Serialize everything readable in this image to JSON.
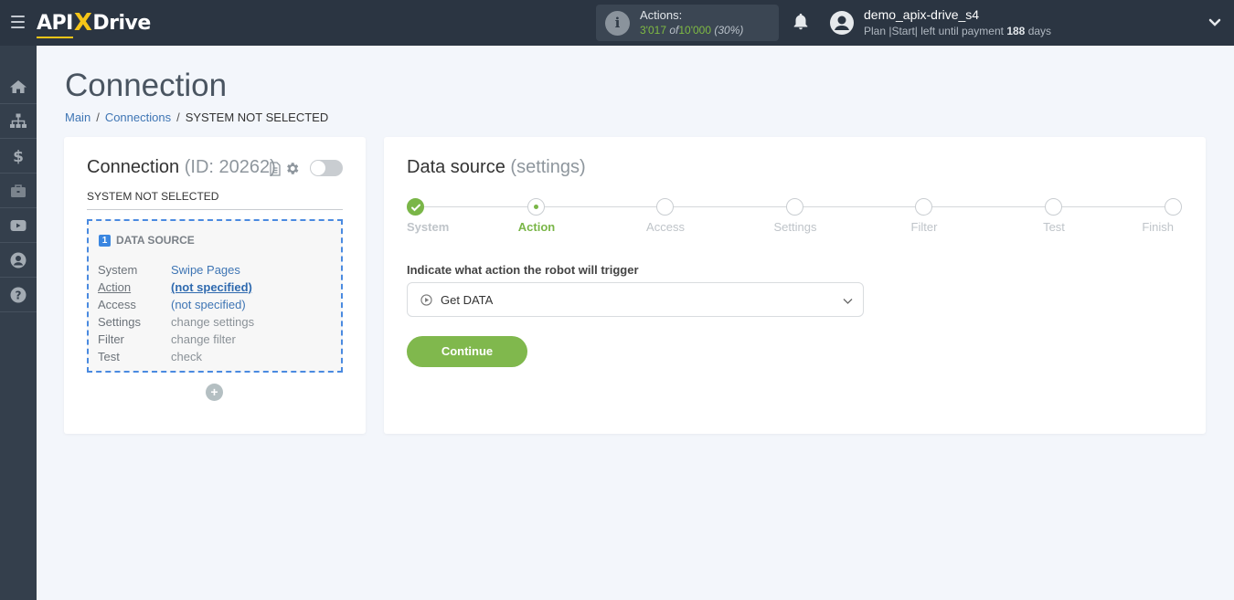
{
  "header": {
    "logo": {
      "part1": "API",
      "part2": "X",
      "part3": "Drive"
    },
    "actions": {
      "label": "Actions:",
      "used": "3'017",
      "of": "of",
      "total": "10'000",
      "percent": "(30%)"
    },
    "user": {
      "name": "demo_apix-drive_s4",
      "plan_prefix": "Plan |Start| left until payment",
      "days_left": "188",
      "days_suffix": "days"
    }
  },
  "sidebar": {
    "items": [
      {
        "icon": "home-icon",
        "label": "Home"
      },
      {
        "icon": "sitemap-icon",
        "label": "Connections"
      },
      {
        "icon": "dollar-icon",
        "label": "Billing"
      },
      {
        "icon": "briefcase-icon",
        "label": "Services"
      },
      {
        "icon": "youtube-icon",
        "label": "Video"
      },
      {
        "icon": "user-icon",
        "label": "Account"
      },
      {
        "icon": "help-icon",
        "label": "Help"
      }
    ]
  },
  "page": {
    "title": "Connection",
    "breadcrumb": [
      {
        "label": "Main"
      },
      {
        "label": "Connections"
      },
      {
        "label": "SYSTEM NOT SELECTED"
      }
    ]
  },
  "connection_card": {
    "title": "Connection",
    "id_text": "(ID: 20262)",
    "system_label": "SYSTEM NOT SELECTED",
    "toggle_enabled": false,
    "data_source": {
      "number": "1",
      "heading": "DATA SOURCE",
      "rows": [
        {
          "key": "System",
          "value": "Swipe Pages"
        },
        {
          "key": "Action",
          "value": "(not specified)"
        },
        {
          "key": "Access",
          "value": "(not specified)"
        },
        {
          "key": "Settings",
          "value": "change settings"
        },
        {
          "key": "Filter",
          "value": "change filter"
        },
        {
          "key": "Test",
          "value": "check"
        }
      ]
    },
    "add_label": "+"
  },
  "settings_card": {
    "title": "Data source",
    "subtitle": "(settings)",
    "steps": [
      {
        "label": "System",
        "state": "done"
      },
      {
        "label": "Action",
        "state": "active"
      },
      {
        "label": "Access",
        "state": "pending"
      },
      {
        "label": "Settings",
        "state": "pending"
      },
      {
        "label": "Filter",
        "state": "pending"
      },
      {
        "label": "Test",
        "state": "pending"
      },
      {
        "label": "Finish",
        "state": "pending"
      }
    ],
    "field_label": "Indicate what action the robot will trigger",
    "select_value": "Get DATA",
    "continue_label": "Continue"
  },
  "colors": {
    "topbar": "#2b3542",
    "sidebar": "#343f4c",
    "accent_green": "#7ab648",
    "link_blue": "#3e75b4",
    "dashed_blue": "#4a8ae0",
    "logo_yellow": "#f5c518"
  }
}
